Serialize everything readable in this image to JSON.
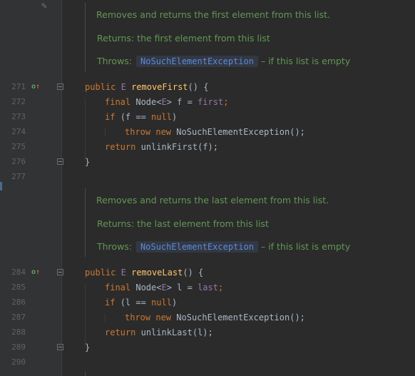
{
  "colors": {
    "background": "#2b2b2b",
    "gutter": "#313335",
    "keyword": "#cc7832",
    "method": "#ffc66d",
    "field": "#9876aa",
    "doc_text": "#629755",
    "doc_link": "#5d8bd8",
    "override_icon": "#59a869"
  },
  "icons": {
    "edit_doc": "pencil-icon",
    "override": "override-gutter-icon",
    "fold": "fold-marker-icon"
  },
  "doc1": {
    "summary": "Removes and returns the first element from this list.",
    "returns": "Returns: the first element from this list",
    "throws_label": "Throws:",
    "throws_exception": "NoSuchElementException",
    "throws_desc": "– if this list is empty"
  },
  "doc2": {
    "summary": "Removes and returns the last element from this list.",
    "returns": "Returns: the last element from this list",
    "throws_label": "Throws:",
    "throws_exception": "NoSuchElementException",
    "throws_desc": "– if this list is empty"
  },
  "method1": {
    "line_numbers": [
      "271",
      "272",
      "273",
      "274",
      "275",
      "276",
      "277"
    ],
    "kw_public": "public",
    "type_param": "E",
    "name": "removeFirst",
    "sig_tail": "() {",
    "kw_final": "final",
    "decl_type": "Node<",
    "decl_type_param": "E",
    "decl_rest": "> f = ",
    "decl_field": "first",
    "decl_end": ";",
    "kw_if": "if",
    "cond_open": "(f == ",
    "kw_null": "null",
    "cond_close": ")",
    "kw_throw": "throw",
    "kw_new": "new",
    "throw_call": "NoSuchElementException();",
    "kw_return": "return",
    "return_call": "unlinkFirst(f);",
    "close_brace": "}"
  },
  "method2": {
    "line_numbers": [
      "284",
      "285",
      "286",
      "287",
      "288",
      "289",
      "290"
    ],
    "kw_public": "public",
    "type_param": "E",
    "name": "removeLast",
    "sig_tail": "() {",
    "kw_final": "final",
    "decl_type": "Node<",
    "decl_type_param": "E",
    "decl_rest": "> l = ",
    "decl_field": "last",
    "decl_end": ";",
    "kw_if": "if",
    "cond_open": "(l == ",
    "kw_null": "null",
    "cond_close": ")",
    "kw_throw": "throw",
    "kw_new": "new",
    "throw_call": "NoSuchElementException();",
    "kw_return": "return",
    "return_call": "unlinkLast(l);",
    "close_brace": "}"
  }
}
